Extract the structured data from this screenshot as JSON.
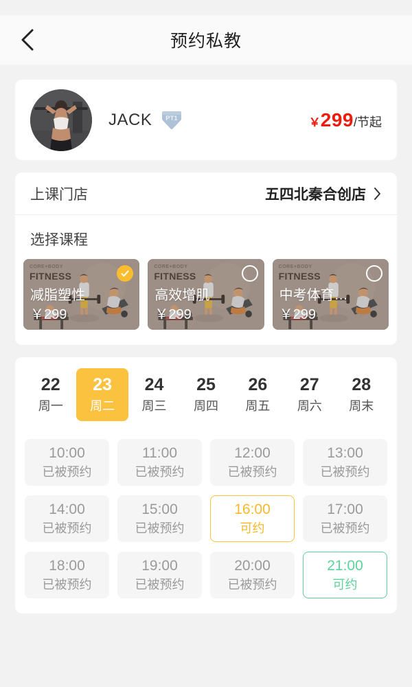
{
  "header": {
    "title": "预约私教",
    "back_icon": "chevron-left-icon"
  },
  "trainer": {
    "name": "JACK",
    "level_badge": "PT1",
    "avatar_alt": "trainer-avatar",
    "price_currency": "￥",
    "price_amount": "299",
    "price_unit": "/节起"
  },
  "store": {
    "label": "上课门店",
    "value": "五四北秦合创店",
    "chevron_icon": "chevron-right-icon"
  },
  "course_section": {
    "title": "选择课程",
    "brand_line": "CORE+BODY",
    "brand": "FITNESS",
    "items": [
      {
        "name": "减脂塑性",
        "price": "￥299",
        "selected": true
      },
      {
        "name": "高效增肌",
        "price": "￥299",
        "selected": false
      },
      {
        "name": "中考体育…",
        "price": "￥299",
        "selected": false
      }
    ]
  },
  "schedule": {
    "dates": [
      {
        "day": "22",
        "dow": "周一",
        "selected": false
      },
      {
        "day": "23",
        "dow": "周二",
        "selected": true
      },
      {
        "day": "24",
        "dow": "周三",
        "selected": false
      },
      {
        "day": "25",
        "dow": "周四",
        "selected": false
      },
      {
        "day": "26",
        "dow": "周五",
        "selected": false
      },
      {
        "day": "27",
        "dow": "周六",
        "selected": false
      },
      {
        "day": "28",
        "dow": "周末",
        "selected": false
      }
    ],
    "slots": [
      {
        "time": "10:00",
        "status": "已被预约",
        "state": "booked"
      },
      {
        "time": "11:00",
        "status": "已被预约",
        "state": "booked"
      },
      {
        "time": "12:00",
        "status": "已被预约",
        "state": "booked"
      },
      {
        "time": "13:00",
        "status": "已被预约",
        "state": "booked"
      },
      {
        "time": "14:00",
        "status": "已被预约",
        "state": "booked"
      },
      {
        "time": "15:00",
        "status": "已被预约",
        "state": "booked"
      },
      {
        "time": "16:00",
        "status": "可约",
        "state": "avail-amber"
      },
      {
        "time": "17:00",
        "status": "已被预约",
        "state": "booked"
      },
      {
        "time": "18:00",
        "status": "已被预约",
        "state": "booked"
      },
      {
        "time": "19:00",
        "status": "已被预约",
        "state": "booked"
      },
      {
        "time": "20:00",
        "status": "已被预约",
        "state": "booked"
      },
      {
        "time": "21:00",
        "status": "可约",
        "state": "avail-green"
      }
    ]
  },
  "colors": {
    "accent_amber": "#fbc23f",
    "accent_green": "#5cd39a",
    "price_red": "#ee1c0f",
    "page_bg": "#f2f2f2",
    "card_bg": "#ffffff",
    "badge_blue": "#a9bdd4"
  }
}
